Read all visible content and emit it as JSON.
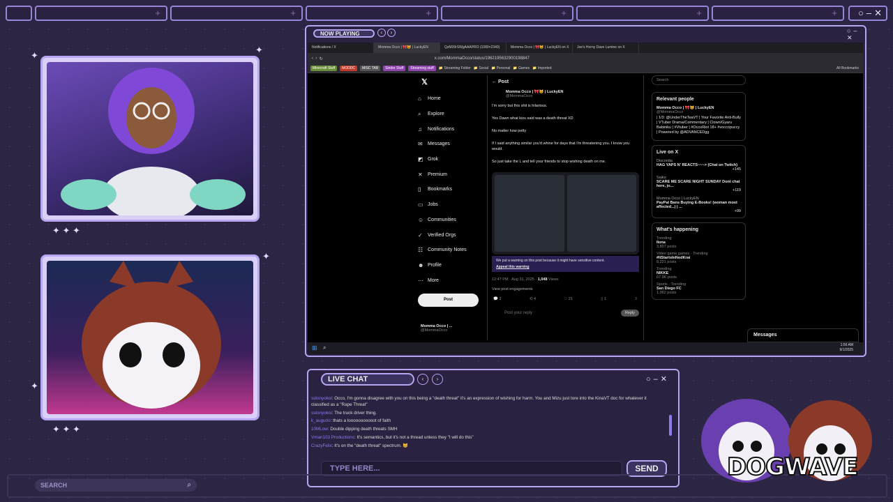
{
  "overlay": {
    "now_playing": "NOW PLAYING",
    "live_chat_title": "LIVE CHAT",
    "chat_placeholder": "TYPE HERE...",
    "send_label": "SEND",
    "search_label": "SEARCH",
    "brand_logo": "DOGWAVE",
    "accent": "#b9a6f2",
    "background": "#2c2543"
  },
  "browser": {
    "tabs": [
      "Notifications / X",
      "Momma Occo | 🎀😺 | LuckyEN",
      "QzM39rSWgAAAPRO (1080×2340)",
      "Momma Occo | 🎀😺 | LuckyEN on X",
      "Joe's Horny Dave Lumine on X"
    ],
    "url": "x.com/MommaOcco/status/1962195632900198847",
    "bookmarks": [
      {
        "label": "Minecraft Stuff",
        "color": "#6b8e3a"
      },
      {
        "label": "MODDC",
        "color": "#c0392b"
      },
      {
        "label": "MISC TAB",
        "color": "#555"
      },
      {
        "label": "Sinder Stuff",
        "color": "#8e44ad"
      },
      {
        "label": "Streaming stuff",
        "color": "#8e44ad"
      }
    ],
    "folders": [
      "Streaming Folder",
      "Social",
      "Personal",
      "Games",
      "Imported"
    ],
    "all_bookmarks": "All Bookmarks"
  },
  "x": {
    "nav": [
      "Home",
      "Explore",
      "Notifications",
      "Messages",
      "Grok",
      "Premium",
      "Bookmarks",
      "Jobs",
      "Communities",
      "Verified Orgs",
      "Community Notes",
      "Profile",
      "More"
    ],
    "post_button": "Post",
    "header": "Post",
    "author": "Momma Occo | 🎀😺 | LuckyEN",
    "handle": "@MommaOcco",
    "paragraphs": [
      "I'm sorry but this shit is hilarious.",
      "Yes Dawn what kizu said was a death threat XD",
      "No matter how petty",
      "If I said anything similar you'd whine for days that I'm threatening you. I know you would.",
      "So just take the L and tell your friends to stop wishing death on me."
    ],
    "warning": "We put a warning on this post because it might have sensitive content.",
    "appeal": "Appeal this warning",
    "timestamp": "12:47 PM · Aug 31, 2025 · ",
    "views_count": "1,048",
    "views_label": " Views",
    "engagements": "View post engagements",
    "counts": [
      "3",
      "4",
      "21",
      "1"
    ],
    "reply_placeholder": "Post your reply",
    "reply_button": "Reply",
    "footer_name": "Momma Occo | ...",
    "footer_handle": "@MommaOcco",
    "search_placeholder": "Search",
    "relevant_title": "Relevant people",
    "relevant_name": "Momma Occo | 🎀😺 | LuckyEN",
    "relevant_handle": "@MommaOcco",
    "relevant_bio": "| 1/3: @UnderTheTeaVT | Your Favorite Anti-Bully | VTuber Drama/Commentary | Clown/Gyaru Babiniku | #Vtuber | #OccoRiot 18+ #voccopuccy | Powered by @ADVANCEDgg",
    "live_title": "Live on X",
    "live": [
      {
        "host": "Discordia",
        "title": "HAG YAPS N' REACTS~~~> (Chat on Twitch)",
        "count": "+145"
      },
      {
        "host": "Saiko",
        "title": "SCARE ME SCARE NIGHT SUNDAY Dont chat here, jo...",
        "count": "+119"
      },
      {
        "host": "Momma Occo | LuckyEN",
        "title": "PayPal Bans Buying E-Books! (woman most affected...) | ...",
        "count": "+99"
      }
    ],
    "happening_title": "What's happening",
    "trends": [
      {
        "cat": "Trending",
        "name": "Ilona",
        "posts": "3,807 posts"
      },
      {
        "cat": "Video game games · Trending",
        "name": "#ItStartsInNodKrai",
        "posts": "8,221 posts"
      },
      {
        "cat": "Trending",
        "name": "NIKKE",
        "posts": "67.9K posts"
      },
      {
        "cat": "Sports · Trending",
        "name": "San Diego FC",
        "posts": "1,362 posts"
      }
    ],
    "messages_label": "Messages"
  },
  "taskbar": {
    "time": "1:56 AM",
    "date": "9/1/2025"
  },
  "chat": {
    "messages": [
      {
        "user": "sstonyokoi",
        "text": "Occo, I'm gonna disagree with you on this being a \"death threat\" it's an expression of wishing for harm. You and Mizu just tore into the KinaVT doc for whatever it classified as a \"Rape Threat\""
      },
      {
        "user": "sstonyokoi",
        "text": "The truck driver thing."
      },
      {
        "user": "k_augurio",
        "text": "thats a looooooooooot of faith"
      },
      {
        "user": "10MLow",
        "text": "Double dipping death threats SMH"
      },
      {
        "user": "Vman103 Productions",
        "text": "It's semantics, but it's not a thread unless they \"I will do this\""
      },
      {
        "user": "CrazyFelix",
        "text": "It's on the \"death threat\" spectrum. 😸"
      }
    ]
  }
}
